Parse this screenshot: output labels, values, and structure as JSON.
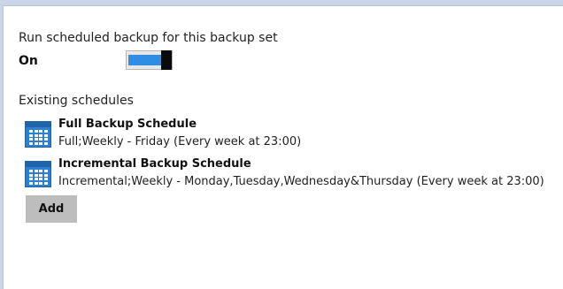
{
  "settings": {
    "run_scheduled_label": "Run scheduled backup for this backup set",
    "toggle_state_label": "On",
    "toggle_on": true
  },
  "schedules": {
    "section_label": "Existing schedules",
    "items": [
      {
        "title": "Full Backup Schedule",
        "description": "Full;Weekly - Friday (Every week at 23:00)",
        "icon": "calendar-icon"
      },
      {
        "title": "Incremental Backup Schedule",
        "description": "Incremental;Weekly - Monday,Tuesday,Wednesday&Thursday (Every week at 23:00)",
        "icon": "calendar-icon"
      }
    ],
    "add_label": "Add"
  },
  "colors": {
    "toggle_accent": "#2f8de4",
    "icon_blue": "#2d7fd0",
    "button_gray": "#bdbdbd"
  }
}
